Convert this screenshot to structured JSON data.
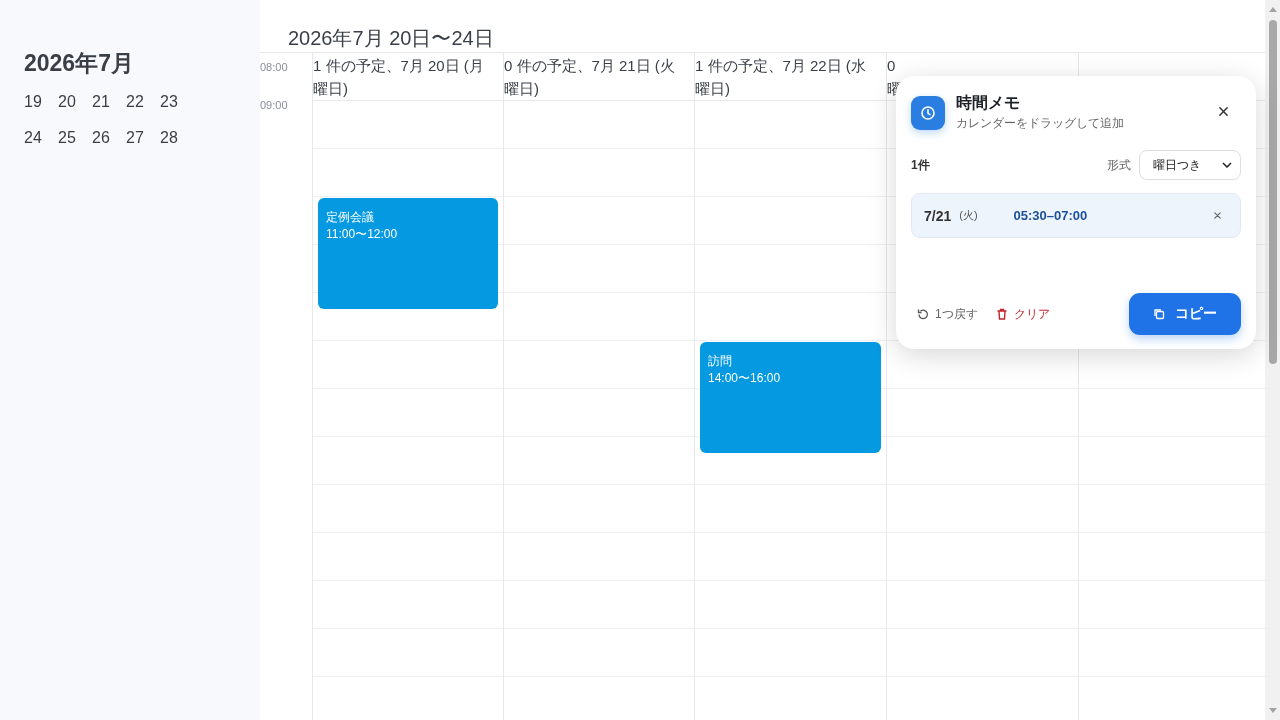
{
  "sidebar": {
    "month_title": "2026年7月",
    "weeks": [
      [
        "19",
        "20",
        "21",
        "22",
        "23"
      ],
      [
        "24",
        "25",
        "26",
        "27",
        "28"
      ]
    ]
  },
  "calendar": {
    "range_title": "2026年7月 20日〜24日",
    "time_labels": [
      "08:00",
      "09:00"
    ],
    "days": [
      {
        "header_lines": [
          "1 件の予定、7月 20日 (月",
          "曜日)"
        ],
        "events": [
          {
            "title": "定例会議",
            "time": "11:00〜12:00",
            "color": "#0599e2"
          }
        ]
      },
      {
        "header_lines": [
          "0 件の予定、7月 21日 (火",
          "曜日)"
        ]
      },
      {
        "header_lines": [
          "1 件の予定、7月 22日 (水",
          "曜日)"
        ],
        "events": [
          {
            "title": "訪問",
            "time": "14:00〜16:00",
            "color": "#0599e2"
          }
        ]
      },
      {
        "header_lines": [
          "0",
          "曜"
        ]
      }
    ]
  },
  "memo_panel": {
    "title": "時間メモ",
    "subtitle": "カレンダーをドラッグして追加",
    "count": "1件",
    "format_label": "形式",
    "format_value": "曜日つき",
    "entries": [
      {
        "date": "7/21",
        "weekday": "(火)",
        "time": "05:30–07:00"
      }
    ],
    "undo_label": "1つ戻す",
    "clear_label": "クリア",
    "copy_label": "コピー"
  }
}
